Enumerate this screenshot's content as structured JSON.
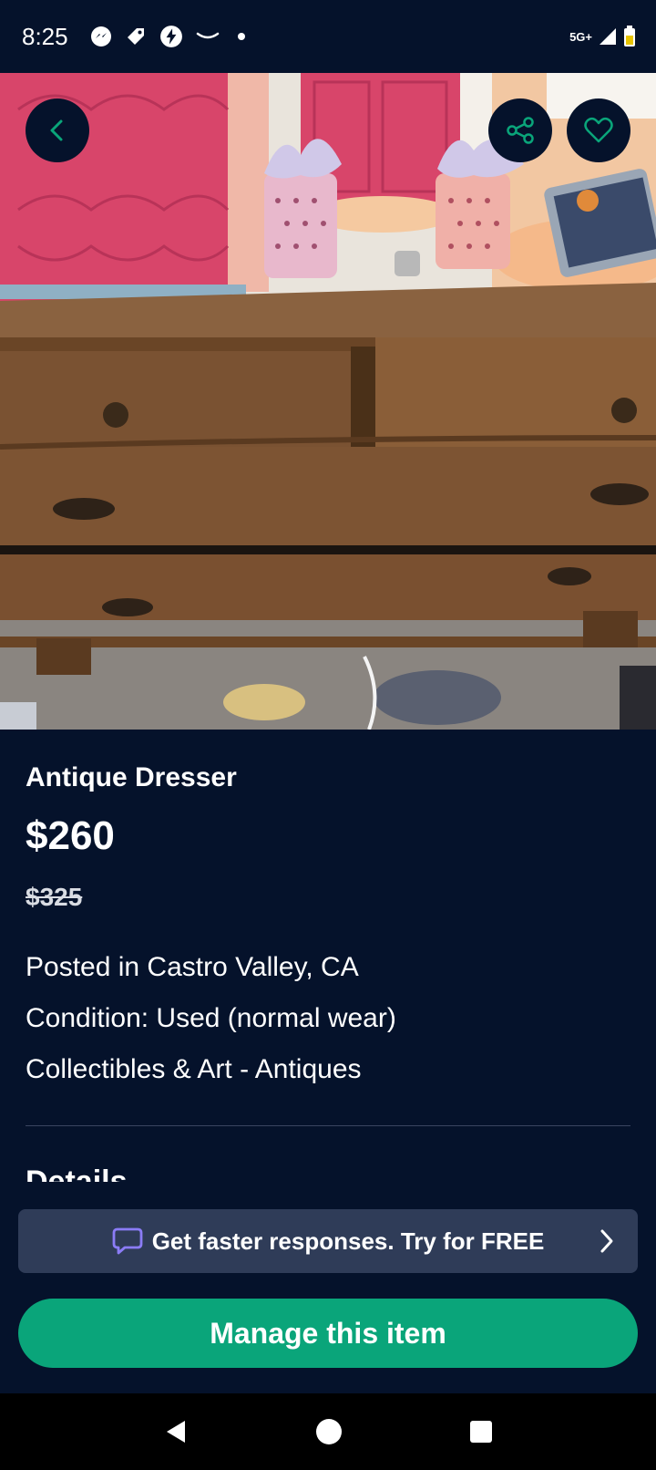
{
  "status_bar": {
    "time": "8:25",
    "network": "5G+",
    "icons": [
      "messenger-icon",
      "tag-icon",
      "bolt-icon",
      "amazon-smile-icon",
      "notification-dot",
      "signal-icon",
      "battery-icon"
    ]
  },
  "hero": {
    "back_icon": "chevron-left-icon",
    "share_icon": "share-icon",
    "favorite_icon": "heart-icon",
    "accent": "#0aa57a"
  },
  "listing": {
    "title": "Antique Dresser",
    "price": "$260",
    "original_price": "$325",
    "location": "Posted in Castro Valley, CA",
    "condition": "Condition: Used (normal wear)",
    "category": "Collectibles & Art - Antiques",
    "details_heading": "Details"
  },
  "promo": {
    "text": "Get faster responses. Try for FREE",
    "icon": "chat-bubble-icon",
    "chevron": "chevron-right-icon"
  },
  "actions": {
    "manage_label": "Manage this item"
  },
  "nav": {
    "back": "back-triangle-icon",
    "home": "home-circle-icon",
    "recents": "recents-square-icon"
  }
}
